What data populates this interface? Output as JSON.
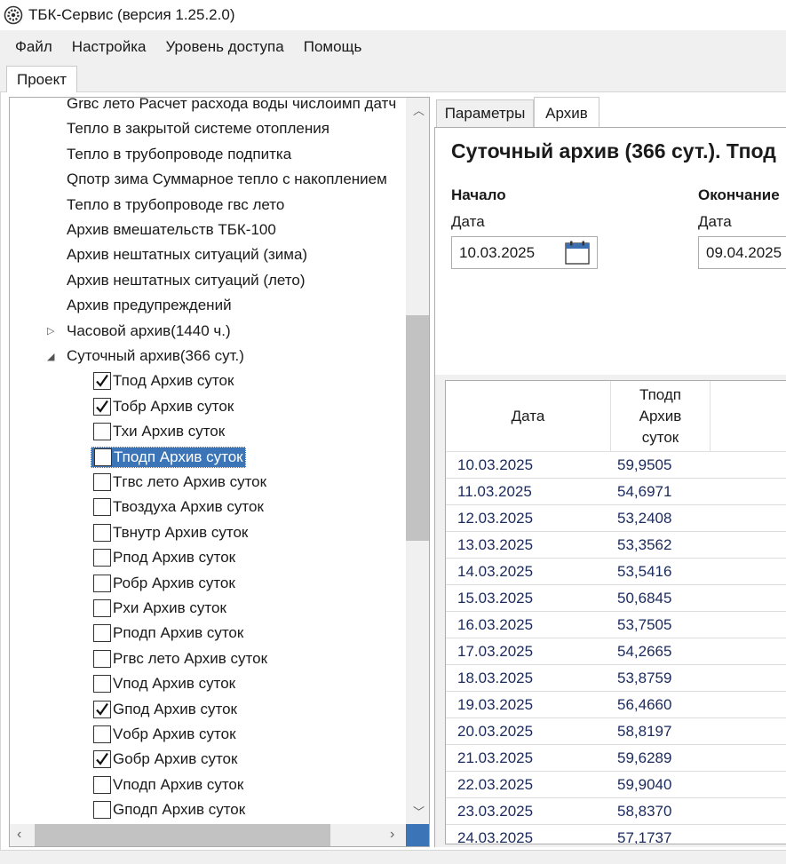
{
  "window": {
    "title": "ТБК-Сервис (версия 1.25.2.0)"
  },
  "menu": [
    "Файл",
    "Настройка",
    "Уровень доступа",
    "Помощь"
  ],
  "project_tab": "Проект",
  "tree": {
    "items": [
      {
        "label": "Grвс лето Расчет расхода воды числоимп датч",
        "level": 1
      },
      {
        "label": "Тепло в закрытой системе отопления",
        "level": 1
      },
      {
        "label": "Тепло в трубопроводе подпитка",
        "level": 1
      },
      {
        "label": "Qпотр зима Суммарное тепло с накоплением",
        "level": 1
      },
      {
        "label": "Тепло в трубопроводе гвс лето",
        "level": 1
      },
      {
        "label": "Архив вмешательств ТБК-100",
        "level": 1
      },
      {
        "label": "Архив нештатных ситуаций (зима)",
        "level": 1
      },
      {
        "label": "Архив нештатных ситуаций (лето)",
        "level": 1
      },
      {
        "label": "Архив предупреждений",
        "level": 1
      },
      {
        "label": "Часовой архив(1440 ч.)",
        "level": 1,
        "expander": "collapsed"
      },
      {
        "label": "Суточный архив(366 сут.)",
        "level": 1,
        "expander": "expanded"
      },
      {
        "label": "Тпод Архив суток",
        "level": 2,
        "checked": true
      },
      {
        "label": "Тобр Архив суток",
        "level": 2,
        "checked": true
      },
      {
        "label": "Тхи Архив суток",
        "level": 2,
        "checked": false
      },
      {
        "label": "Тподп Архив суток",
        "level": 2,
        "checked": false,
        "selected": true
      },
      {
        "label": "Тгвс лето Архив суток",
        "level": 2,
        "checked": false
      },
      {
        "label": "Твоздуха Архив суток",
        "level": 2,
        "checked": false
      },
      {
        "label": "Твнутр Архив суток",
        "level": 2,
        "checked": false
      },
      {
        "label": "Рпод Архив суток",
        "level": 2,
        "checked": false
      },
      {
        "label": "Робр Архив суток",
        "level": 2,
        "checked": false
      },
      {
        "label": "Рхи Архив суток",
        "level": 2,
        "checked": false
      },
      {
        "label": "Рподп Архив суток",
        "level": 2,
        "checked": false
      },
      {
        "label": "Ргвс лето Архив суток",
        "level": 2,
        "checked": false
      },
      {
        "label": "Vпод Архив суток",
        "level": 2,
        "checked": false
      },
      {
        "label": "Gпод Архив суток",
        "level": 2,
        "checked": true
      },
      {
        "label": "Vобр Архив суток",
        "level": 2,
        "checked": false
      },
      {
        "label": "Gобр Архив суток",
        "level": 2,
        "checked": true
      },
      {
        "label": "Vподп Архив суток",
        "level": 2,
        "checked": false
      },
      {
        "label": "Gподп Архив суток",
        "level": 2,
        "checked": false
      }
    ]
  },
  "right": {
    "tabs": [
      "Параметры",
      "Архив"
    ],
    "active_tab": "Архив",
    "title": "Суточный архив (366 сут.). Тпод",
    "start": {
      "heading": "Начало",
      "date_label": "Дата",
      "date_value": "10.03.2025"
    },
    "end": {
      "heading": "Окончание",
      "date_label": "Дата",
      "date_value": "09.04.2025"
    },
    "calendar_icon_text": "15",
    "grid": {
      "columns": [
        "Дата",
        "Тподп\nАрхив\nсуток"
      ],
      "rows": [
        [
          "10.03.2025",
          "59,9505"
        ],
        [
          "11.03.2025",
          "54,6971"
        ],
        [
          "12.03.2025",
          "53,2408"
        ],
        [
          "13.03.2025",
          "53,3562"
        ],
        [
          "14.03.2025",
          "53,5416"
        ],
        [
          "15.03.2025",
          "50,6845"
        ],
        [
          "16.03.2025",
          "53,7505"
        ],
        [
          "17.03.2025",
          "54,2665"
        ],
        [
          "18.03.2025",
          "53,8759"
        ],
        [
          "19.03.2025",
          "56,4660"
        ],
        [
          "20.03.2025",
          "58,8197"
        ],
        [
          "21.03.2025",
          "59,6289"
        ],
        [
          "22.03.2025",
          "59,9040"
        ],
        [
          "23.03.2025",
          "58,8370"
        ],
        [
          "24.03.2025",
          "57,1737"
        ]
      ]
    }
  },
  "colors": {
    "selection": "#3b75b8",
    "grid_text": "#1b2a5c",
    "chrome": "#f0f0f0"
  }
}
